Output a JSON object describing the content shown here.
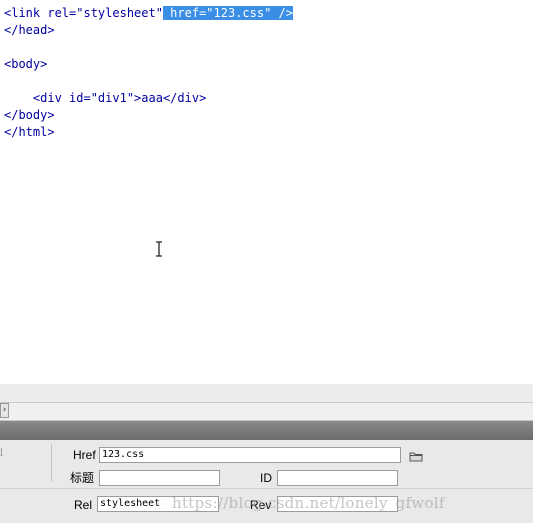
{
  "editor": {
    "lines": {
      "l1_pre": "<link rel=\"stylesheet\"",
      "l1_sel": " href=\"123.css\" />",
      "l2": "</head>",
      "l3": "",
      "l4": "<body>",
      "l5": "",
      "l6": "    <div id=\"div1\">aaa</div>",
      "l7": "</body>",
      "l8": "</html>"
    },
    "selection_color": "#3a8ee6",
    "code_color": "#0000a0"
  },
  "scrollbar": {
    "left_arrow": "›"
  },
  "properties": {
    "edge_glyph": "⁞",
    "href_label": "Href",
    "href_value": "123.css",
    "title_label": "标题",
    "title_value": "",
    "id_label": "ID",
    "id_value": "",
    "rel_label": "Rel",
    "rel_value": "stylesheet",
    "rev_label": "Rev",
    "rev_value": ""
  },
  "watermark": "https://blog.csdn.net/lonely_gfwolf"
}
